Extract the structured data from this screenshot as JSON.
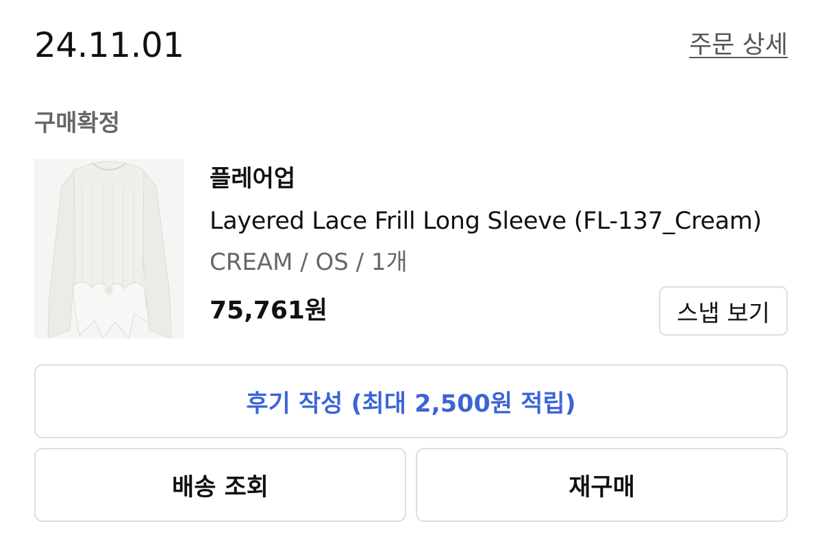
{
  "order": {
    "date": "24.11.01",
    "detail_link": "주문 상세",
    "status": "구매확정"
  },
  "product": {
    "image_icon": "cream-lace-long-sleeve-top",
    "brand": "플레어업",
    "name": "Layered Lace Frill Long Sleeve (FL-137_Cream)",
    "option": "CREAM / OS / 1개",
    "price": "75,761원",
    "snap_label": "스냅 보기"
  },
  "actions": {
    "review_label": "후기 작성 (최대 2,500원 적립)",
    "track_label": "배송 조회",
    "rebuy_label": "재구매"
  },
  "colors": {
    "accent": "#3b64d6",
    "muted_text": "#666666",
    "border": "#dddddd"
  }
}
